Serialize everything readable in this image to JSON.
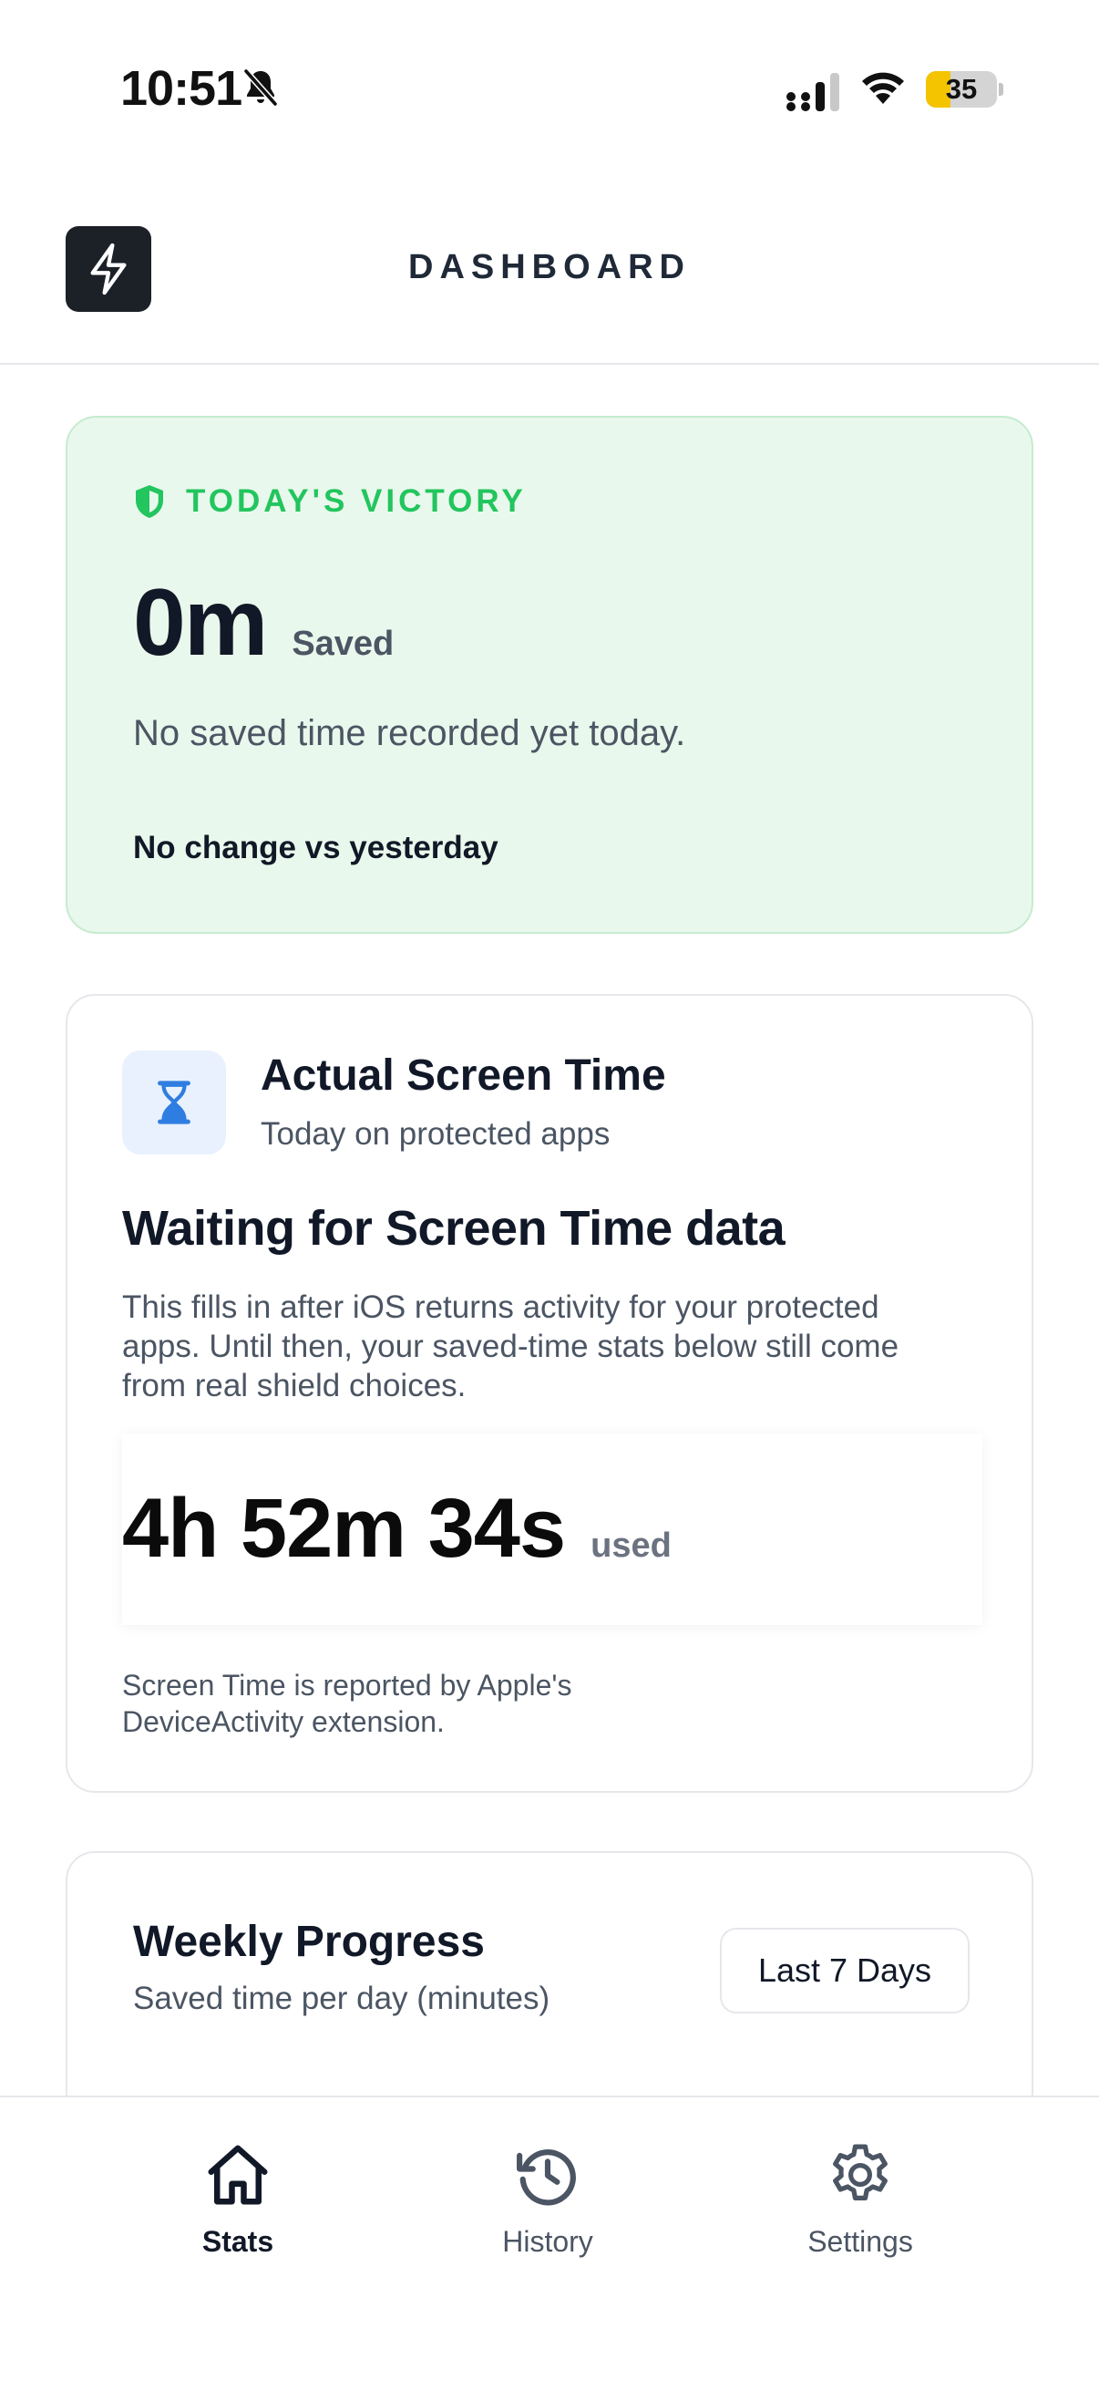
{
  "status_bar": {
    "time": "10:51",
    "battery": "35",
    "battery_level": 0.35
  },
  "header": {
    "title": "DASHBOARD",
    "logo_icon": "lightning-bolt-icon"
  },
  "victory": {
    "label": "TODAY'S VICTORY",
    "value": "0m",
    "unit": "Saved",
    "message": "No saved time recorded yet today.",
    "change": "No change vs yesterday",
    "accent_color": "#22c55e",
    "background_color": "#e9f8ec"
  },
  "screen_time": {
    "title": "Actual Screen Time",
    "subtitle": "Today on protected apps",
    "waiting_title": "Waiting for Screen Time data",
    "description": "This fills in after iOS returns activity for your protected apps. Until then, your saved-time stats below still come from real shield choices.",
    "usage_value": "4h 52m 34s",
    "usage_unit": "used",
    "footnote": "Screen Time is reported by Apple's DeviceActivity extension.",
    "icon": "hourglass-icon",
    "icon_color": "#2f7de1"
  },
  "weekly": {
    "title": "Weekly Progress",
    "subtitle": "Saved time per day (minutes)",
    "range_label": "Last 7 Days"
  },
  "tabs": [
    {
      "label": "Stats",
      "icon": "home-icon",
      "active": true
    },
    {
      "label": "History",
      "icon": "history-icon",
      "active": false
    },
    {
      "label": "Settings",
      "icon": "gear-icon",
      "active": false
    }
  ]
}
